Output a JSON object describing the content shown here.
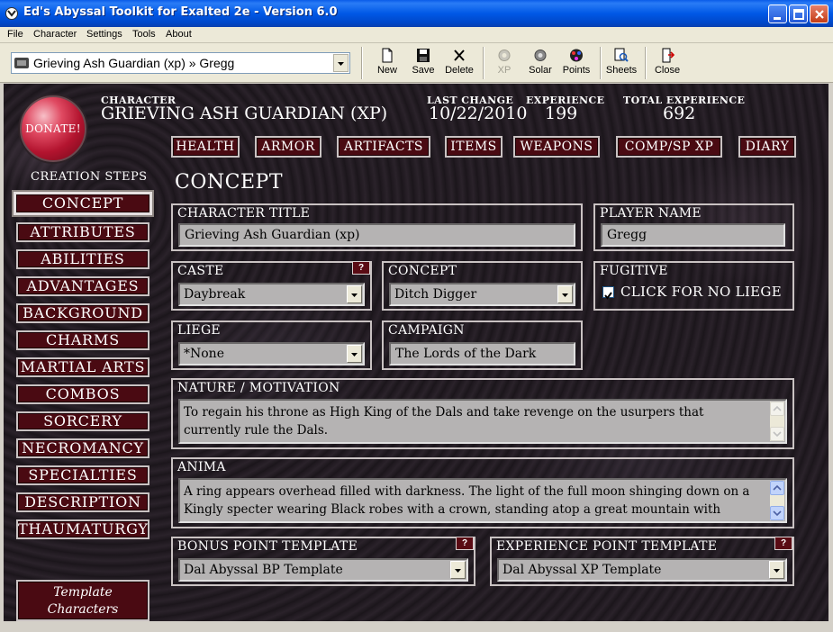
{
  "window": {
    "title": "Ed's Abyssal Toolkit for Exalted 2e - Version 6.0"
  },
  "menu": [
    "File",
    "Character",
    "Settings",
    "Tools",
    "About"
  ],
  "toolbar": {
    "character_select": "Grieving Ash Guardian (xp) » Gregg",
    "buttons": {
      "new": "New",
      "save": "Save",
      "delete": "Delete",
      "xp": "XP",
      "solar": "Solar",
      "points": "Points",
      "sheets": "Sheets",
      "close": "Close"
    }
  },
  "header": {
    "donate": "DONATE!",
    "character_label": "CHARACTER",
    "character_name": "GRIEVING ASH GUARDIAN (XP)",
    "last_change_label": "LAST CHANGE",
    "last_change": "10/22/2010",
    "experience_label": "EXPERIENCE",
    "experience": "199",
    "total_experience_label": "TOTAL EXPERIENCE",
    "total_experience": "692"
  },
  "tabs": [
    "Health",
    "Armor",
    "Artifacts",
    "Items",
    "Weapons",
    "Comp/Sp XP",
    "Diary"
  ],
  "creation_steps": {
    "title": "CREATION STEPS",
    "items": [
      "Concept",
      "Attributes",
      "Abilities",
      "Advantages",
      "Background",
      "Charms",
      "Martial Arts",
      "Combos",
      "Sorcery",
      "Necromancy",
      "Specialties",
      "Description",
      "Thaumaturgy"
    ],
    "active": "Concept",
    "template_line1": "Template",
    "template_line2": "Characters"
  },
  "concept": {
    "section_title": "CONCEPT",
    "character_title_label": "CHARACTER TITLE",
    "character_title": "Grieving Ash Guardian (xp)",
    "player_name_label": "PLAYER NAME",
    "player_name": "Gregg",
    "caste_label": "CASTE",
    "caste": "Daybreak",
    "concept_label": "CONCEPT",
    "concept": "Ditch Digger",
    "fugitive_label": "FUGITIVE",
    "fugitive_checkbox_label": "CLICK FOR NO LIEGE",
    "fugitive_checked": true,
    "liege_label": "LIEGE",
    "liege": "*None",
    "campaign_label": "CAMPAIGN",
    "campaign": "The Lords of the Dark",
    "nature_label": "NATURE / MOTIVATION",
    "nature": "To regain his throne as High King of the Dals and take revenge on the usurpers that currently rule the Dals.",
    "anima_label": "ANIMA",
    "anima": "A ring appears overhead filled with darkness. The light of the full moon shinging down on a Kingly specter wearing Black robes with a crown, standing atop a great mountain with chains",
    "bonus_template_label": "BONUS POINT TEMPLATE",
    "bonus_template": "Dal Abyssal BP Template",
    "xp_template_label": "EXPERIENCE POINT TEMPLATE",
    "xp_template": "Dal Abyssal XP Template",
    "help_mark": "?"
  },
  "colors": {
    "title_bar": "#0058e6",
    "panel_bg": "#1e181e",
    "button_red": "#4a0a12",
    "field_gray": "#b5b3b3"
  }
}
